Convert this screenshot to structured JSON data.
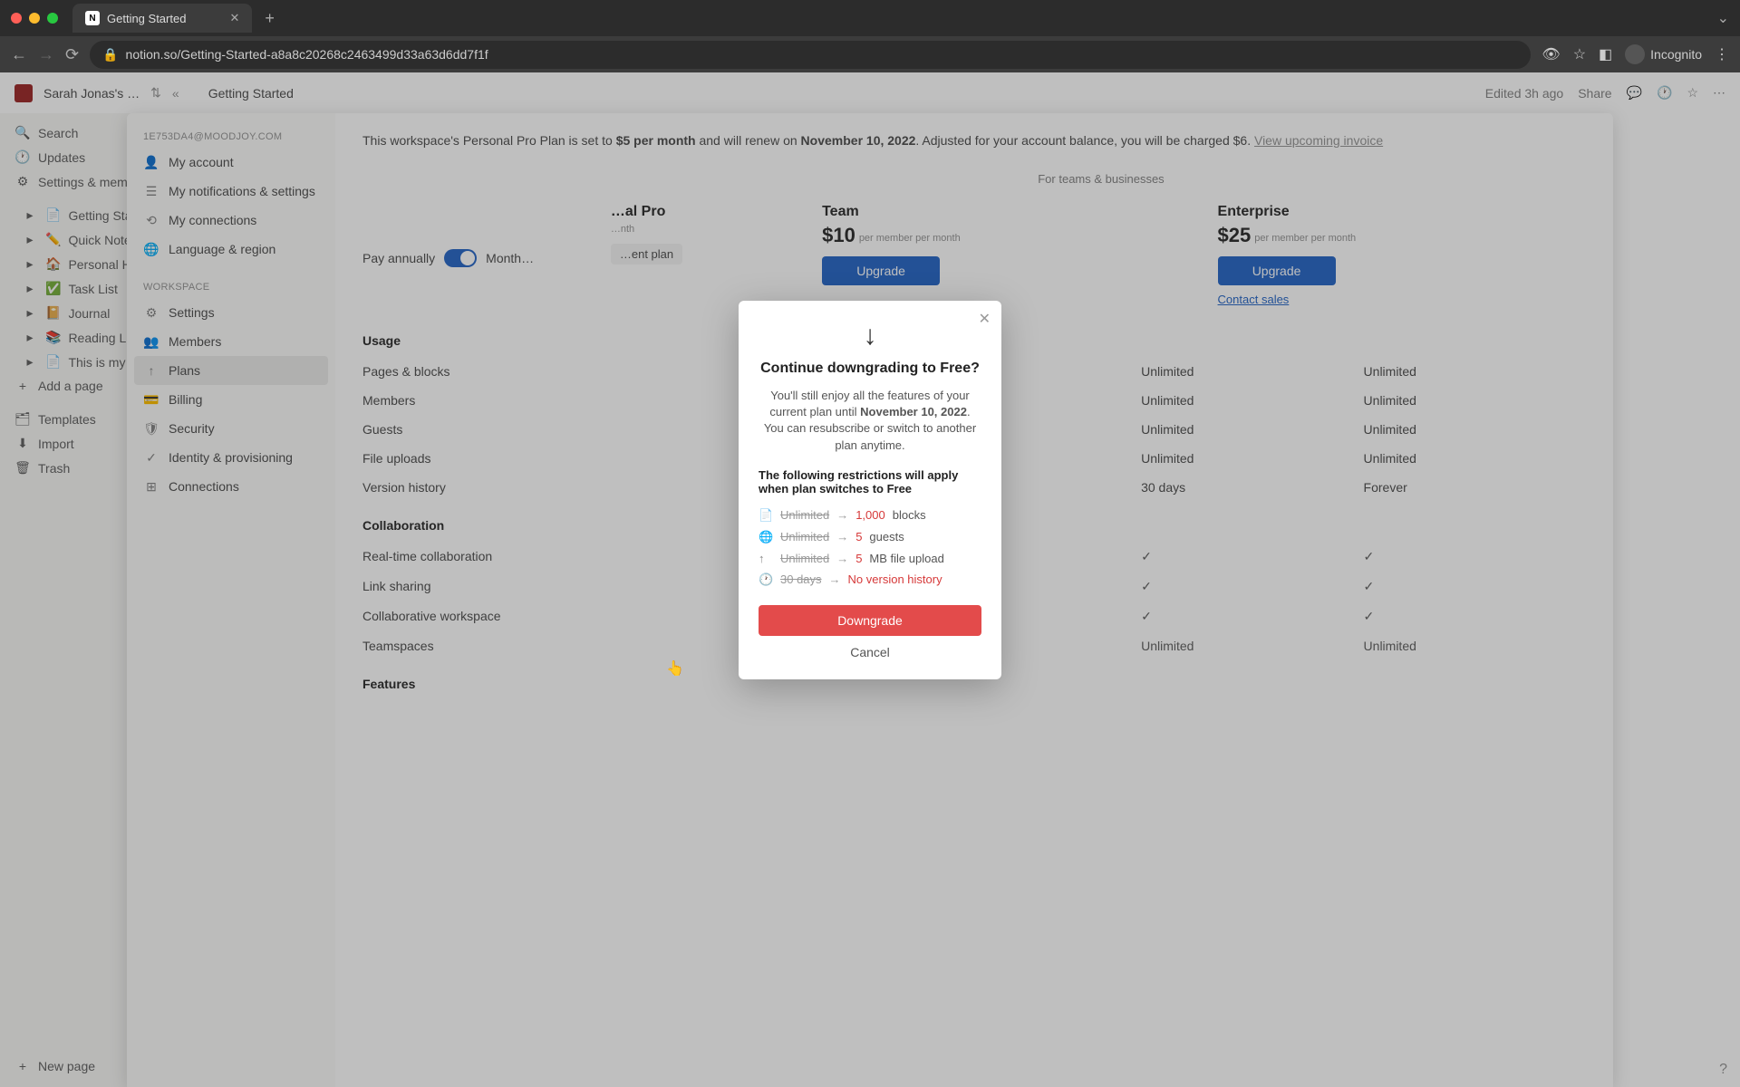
{
  "browser": {
    "tab_title": "Getting Started",
    "url": "notion.so/Getting-Started-a8a8c20268c2463499d33a63d6dd7f1f",
    "incognito_label": "Incognito"
  },
  "topbar": {
    "workspace_name": "Sarah Jonas's …",
    "breadcrumb": "Getting Started",
    "edited_label": "Edited 3h ago",
    "share_label": "Share"
  },
  "left_sidebar": {
    "search": "Search",
    "updates": "Updates",
    "settings": "Settings & mem…",
    "pages": [
      "Getting Start…",
      "Quick Note",
      "Personal Hom…",
      "Task List",
      "Journal",
      "Reading List",
      "This is my pa…"
    ],
    "add_page": "Add a page",
    "templates": "Templates",
    "import": "Import",
    "trash": "Trash",
    "new_page": "New page"
  },
  "settings_nav": {
    "email": "1E753DA4@MOODJOY.COM",
    "account": [
      "My account",
      "My notifications & settings",
      "My connections",
      "Language & region"
    ],
    "workspace_header": "WORKSPACE",
    "workspace": [
      "Settings",
      "Members",
      "Plans",
      "Billing",
      "Security",
      "Identity & provisioning",
      "Connections"
    ]
  },
  "plan_banner": {
    "prefix": "This workspace's Personal Pro Plan is set to ",
    "price": "$5 per month",
    "renew_text": " and will renew on ",
    "renew_date": "November 10, 2022",
    "suffix": ". Adjusted for your account balance, you will be charged $6. ",
    "invoice_link": "View upcoming invoice"
  },
  "billing": {
    "pay_annually": "Pay annually",
    "monthly": "Month…",
    "section_header_biz": "For teams & businesses"
  },
  "plans": {
    "personal_pro": {
      "name": "…al Pro",
      "sub": "…nth",
      "current": "…ent plan"
    },
    "team": {
      "name": "Team",
      "price": "$10",
      "sub": "per member\nper month",
      "btn": "Upgrade"
    },
    "enterprise": {
      "name": "Enterprise",
      "price": "$25",
      "sub": "per member\nper month",
      "btn": "Upgrade",
      "contact": "Contact sales"
    }
  },
  "usage": {
    "header": "Usage",
    "rows": [
      {
        "label": "Pages & blocks",
        "team": "Unlimited",
        "ent": "Unlimited"
      },
      {
        "label": "Members",
        "team": "Unlimited",
        "ent": "Unlimited"
      },
      {
        "label": "Guests",
        "team": "Unlimited",
        "ent": "Unlimited"
      },
      {
        "label": "File uploads",
        "team": "Unlimited",
        "ent": "Unlimited"
      },
      {
        "label": "Version history",
        "team": "30 days",
        "ent": "Forever"
      }
    ],
    "collab_header": "Collaboration",
    "collab_rows": [
      {
        "label": "Real-time collaboration",
        "team": "✓",
        "ent": "✓"
      },
      {
        "label": "Link sharing",
        "team": "✓",
        "ent": "✓"
      },
      {
        "label": "Collaborative workspace",
        "team": "✓",
        "ent": "✓"
      },
      {
        "label": "Teamspaces",
        "team": "Unlimited",
        "ent": "Unlimited"
      }
    ],
    "features_header": "Features"
  },
  "modal": {
    "title": "Continue downgrading to Free?",
    "body_prefix": "You'll still enjoy all the features of your current plan until ",
    "body_date": "November 10, 2022",
    "body_suffix": ". You can resubscribe or switch to another plan anytime.",
    "restrictions_title": "The following restrictions will apply when plan switches to Free",
    "items": [
      {
        "old": "Unlimited",
        "new": "1,000",
        "suffix": " blocks"
      },
      {
        "old": "Unlimited",
        "new": "5",
        "suffix": " guests"
      },
      {
        "old": "Unlimited",
        "new": "5",
        "suffix": " MB file upload"
      },
      {
        "old": "30 days",
        "new": "No version history",
        "suffix": ""
      }
    ],
    "downgrade_btn": "Downgrade",
    "cancel_btn": "Cancel"
  }
}
